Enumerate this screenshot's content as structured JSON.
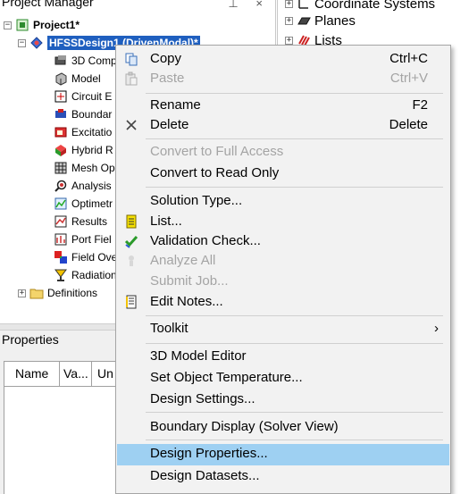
{
  "project_manager": {
    "title": "Project Manager",
    "title_icons": "⊥ ×",
    "project_name": "Project1*",
    "design_name": "HFSSDesign1 (DrivenModal)*",
    "items": [
      {
        "label": "3D Comp",
        "icon": "3d-components-icon"
      },
      {
        "label": "Model",
        "icon": "model-icon"
      },
      {
        "label": "Circuit E",
        "icon": "circuit-elements-icon"
      },
      {
        "label": "Boundar",
        "icon": "boundaries-icon"
      },
      {
        "label": "Excitatio",
        "icon": "excitations-icon"
      },
      {
        "label": "Hybrid R",
        "icon": "hybrid-regions-icon"
      },
      {
        "label": "Mesh Op",
        "icon": "mesh-operations-icon"
      },
      {
        "label": "Analysis",
        "icon": "analysis-icon"
      },
      {
        "label": "Optimetr",
        "icon": "optimetrics-icon"
      },
      {
        "label": "Results",
        "icon": "results-icon"
      },
      {
        "label": "Port Fiel",
        "icon": "port-field-display-icon"
      },
      {
        "label": "Field Ove",
        "icon": "field-overlays-icon"
      },
      {
        "label": "Radiation",
        "icon": "radiation-icon"
      }
    ],
    "definitions_label": "Definitions"
  },
  "properties": {
    "title": "Properties",
    "columns": [
      "Name",
      "Va...",
      "Un"
    ]
  },
  "right_tree": {
    "items": [
      {
        "label": "Coordinate Systems"
      },
      {
        "label": "Planes"
      },
      {
        "label": "Lists"
      }
    ]
  },
  "context_menu": {
    "items": {
      "copy": {
        "label": "Copy",
        "accel": "Ctrl+C"
      },
      "paste": {
        "label": "Paste",
        "accel": "Ctrl+V"
      },
      "rename": {
        "label": "Rename",
        "accel": "F2"
      },
      "delete": {
        "label": "Delete",
        "accel": "Delete"
      },
      "convert_full": {
        "label": "Convert to Full Access"
      },
      "convert_readonly": {
        "label": "Convert to Read Only"
      },
      "solution_type": {
        "label": "Solution Type..."
      },
      "list": {
        "label": "List..."
      },
      "validation_check": {
        "label": "Validation Check..."
      },
      "analyze_all": {
        "label": "Analyze All"
      },
      "submit_job": {
        "label": "Submit Job..."
      },
      "edit_notes": {
        "label": "Edit Notes..."
      },
      "toolkit": {
        "label": "Toolkit",
        "arrow": "›"
      },
      "model_editor": {
        "label": "3D Model Editor"
      },
      "set_temp": {
        "label": "Set Object Temperature..."
      },
      "design_settings": {
        "label": "Design Settings..."
      },
      "boundary_display": {
        "label": "Boundary Display (Solver View)"
      },
      "design_properties": {
        "label": "Design Properties..."
      },
      "design_datasets": {
        "label": "Design Datasets..."
      }
    },
    "highlight_color": "#9ed0f2",
    "disabled_color": "#a4a4a4"
  }
}
